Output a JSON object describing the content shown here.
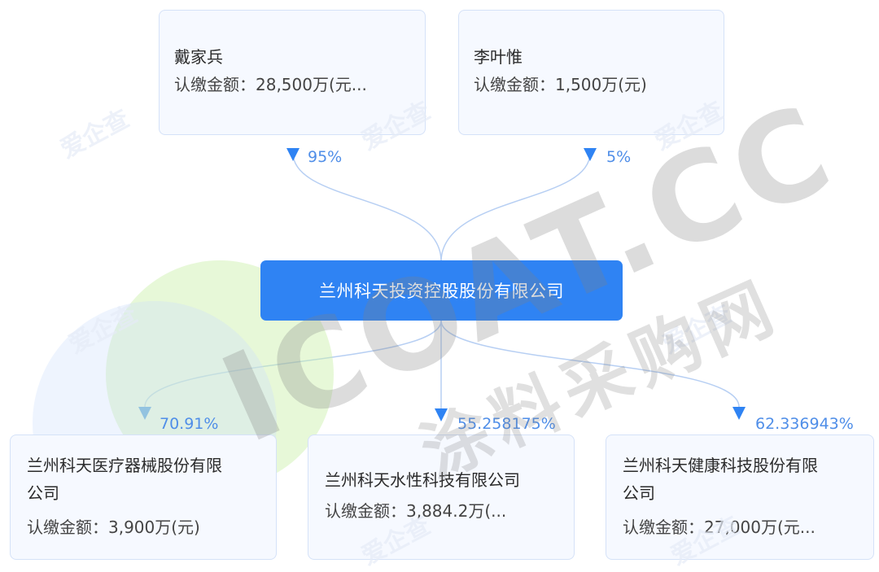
{
  "shareholders": [
    {
      "name": "戴家兵",
      "amount": "认缴金额：28,500万(元...",
      "percent": "95%"
    },
    {
      "name": "李叶惟",
      "amount": "认缴金额：1,500万(元)",
      "percent": "5%"
    }
  ],
  "center_company": "兰州科天投资控股股份有限公司",
  "subsidiaries": [
    {
      "name_line1": "兰州科天医疗器械股份有限",
      "name_line2": "公司",
      "amount": "认缴金额：3,900万(元)",
      "percent": "70.91%"
    },
    {
      "name_line1": "兰州科天水性科技有限公司",
      "name_line2": "",
      "amount": "认缴金额：3,884.2万(...",
      "percent": "55.258175%"
    },
    {
      "name_line1": "兰州科天健康科技股份有限",
      "name_line2": "公司",
      "amount": "认缴金额：27,000万(元...",
      "percent": "62.336943%"
    }
  ],
  "watermarks": {
    "site": "爱企查",
    "brand": "ICOAT.CC",
    "brand_cn": "涂料采购网"
  },
  "colors": {
    "accent": "#2f83f3",
    "connector": "#a9c6f0",
    "percent_text": "#4f8ee8",
    "node_bg": "#f6f9ff"
  }
}
